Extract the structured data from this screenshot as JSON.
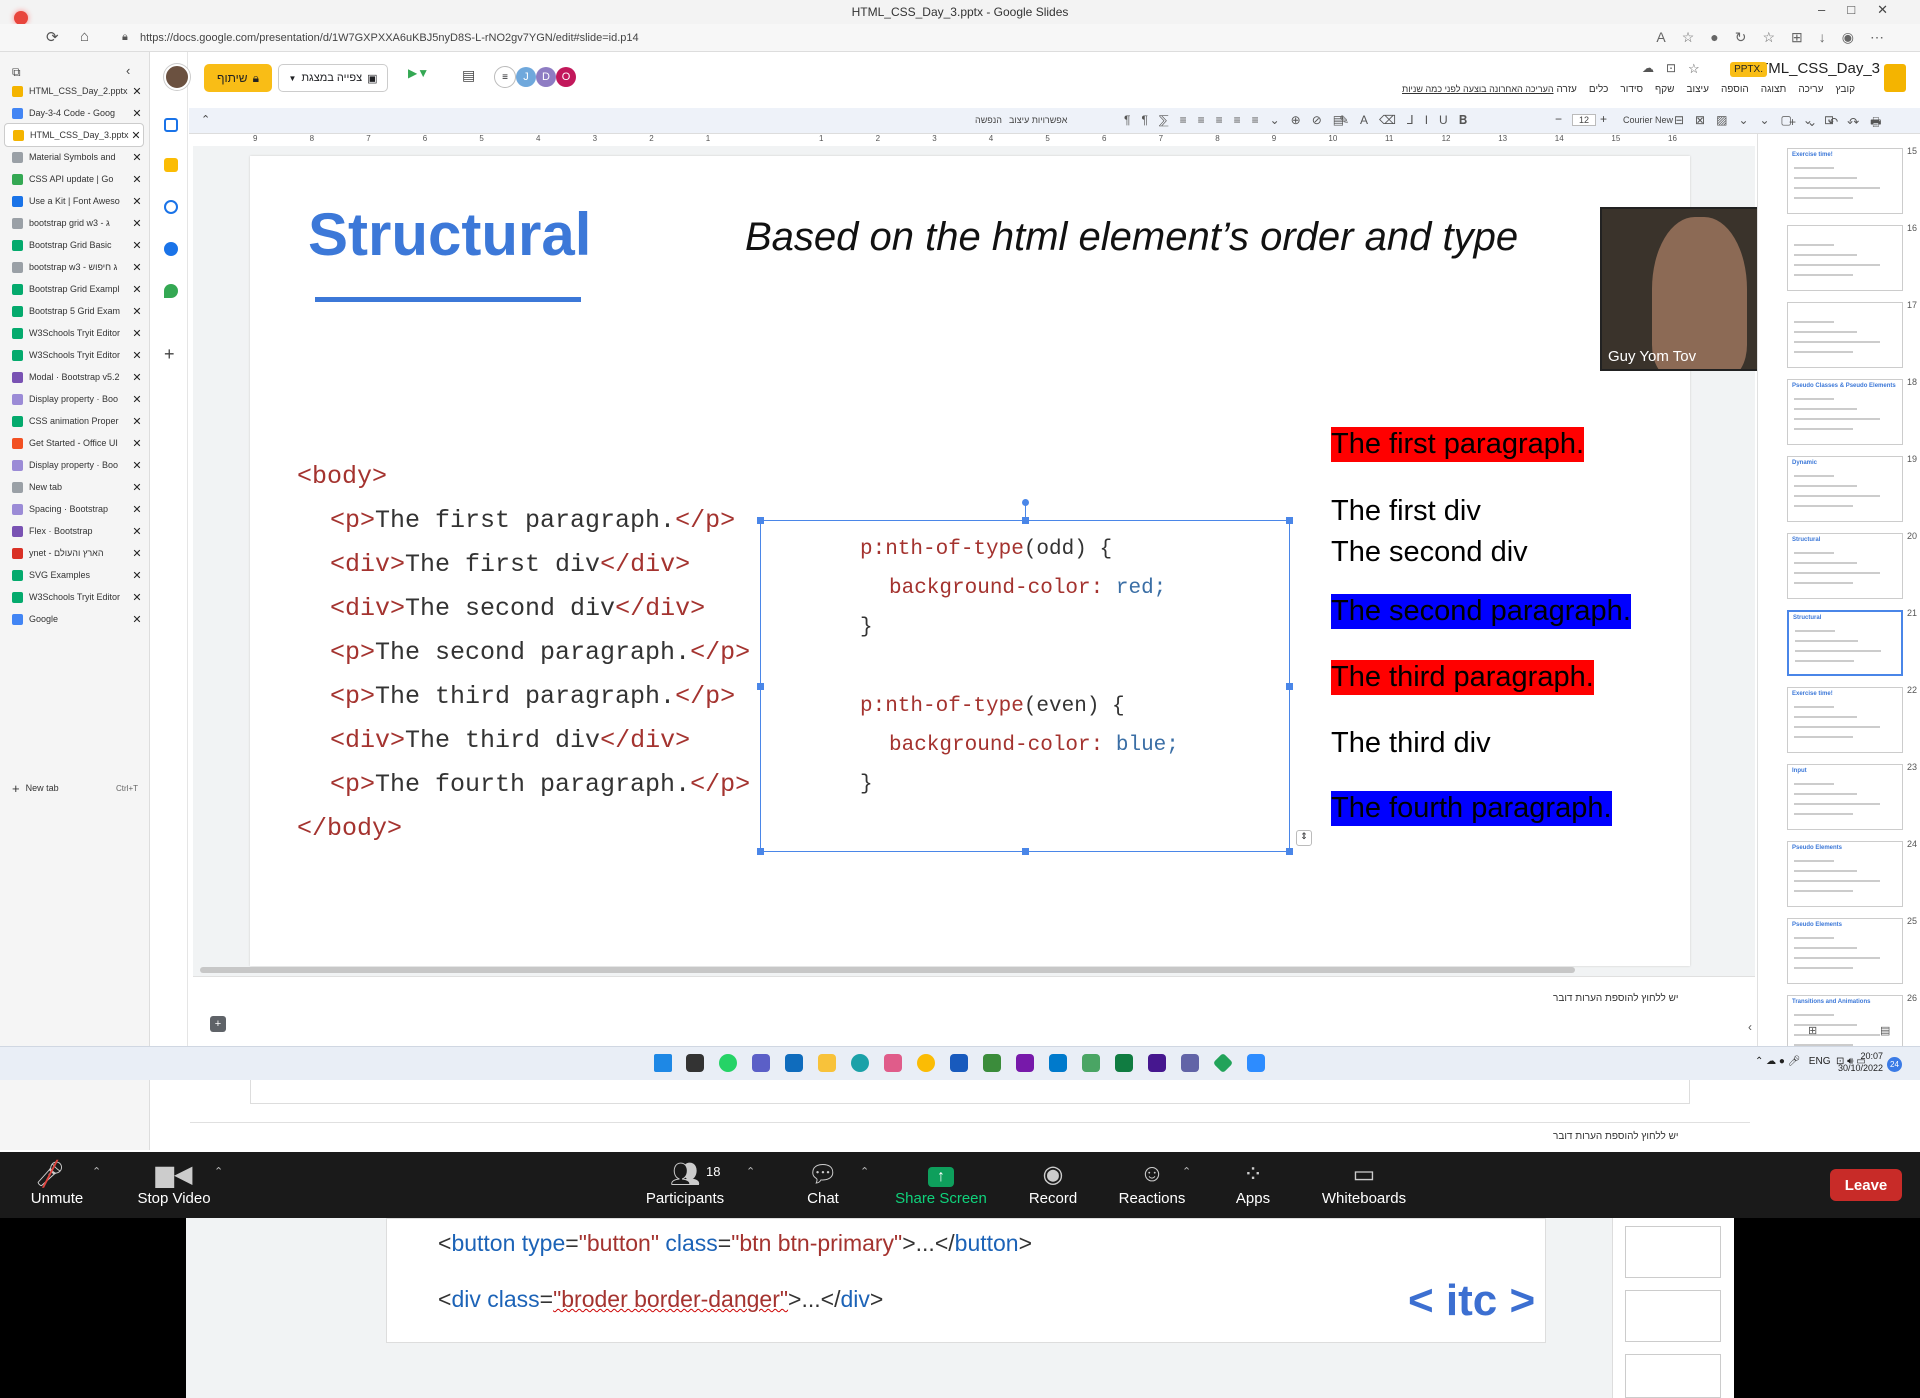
{
  "window": {
    "title": "HTML_CSS_Day_3.pptx - Google Slides",
    "controls": "–□✕"
  },
  "browser": {
    "url": "https://docs.google.com/presentation/d/1W7GXPXXA6uKBJ5nyD8S-L-rNO2gv7YGN/edit#slide=id.p14",
    "tabs": [
      {
        "label": "HTML_CSS_Day_2.pptx",
        "color": "#f4b400"
      },
      {
        "label": "Day-3-4 Code - Goog",
        "color": "#4285f4"
      },
      {
        "label": "HTML_CSS_Day_3.pptx",
        "color": "#f4b400",
        "active": true
      },
      {
        "label": "Material Symbols and",
        "color": "#9aa0a6"
      },
      {
        "label": "CSS API update | Go",
        "color": "#34a853"
      },
      {
        "label": "Use a Kit | Font Aweso",
        "color": "#1a73e8"
      },
      {
        "label": "bootstrap grid w3 - ג",
        "color": "#9aa0a6"
      },
      {
        "label": "Bootstrap Grid Basic",
        "color": "#04aa6d"
      },
      {
        "label": "bootstrap w3 - ג חיפוש",
        "color": "#9aa0a6"
      },
      {
        "label": "Bootstrap Grid Exampl",
        "color": "#04aa6d"
      },
      {
        "label": "Bootstrap 5 Grid Exam",
        "color": "#04aa6d"
      },
      {
        "label": "W3Schools Tryit Editor",
        "color": "#04aa6d"
      },
      {
        "label": "W3Schools Tryit Editor",
        "color": "#04aa6d"
      },
      {
        "label": "Modal · Bootstrap v5.2",
        "color": "#7952b3"
      },
      {
        "label": "Display property · Boo",
        "color": "#9b8bd6"
      },
      {
        "label": "CSS animation Proper",
        "color": "#04aa6d"
      },
      {
        "label": "Get Started - Office UI",
        "color": "#f25022"
      },
      {
        "label": "Display property · Boo",
        "color": "#9b8bd6"
      },
      {
        "label": "New tab",
        "color": "#9aa0a6"
      },
      {
        "label": "Spacing · Bootstrap",
        "color": "#9b8bd6"
      },
      {
        "label": "Flex · Bootstrap",
        "color": "#7952b3"
      },
      {
        "label": "ynet - הארץ והעולם",
        "color": "#d93025"
      },
      {
        "label": "SVG Examples",
        "color": "#04aa6d"
      },
      {
        "label": "W3Schools Tryit Editor",
        "color": "#04aa6d"
      },
      {
        "label": "Google",
        "color": "#4285f4"
      }
    ],
    "new_tab_label": "New tab",
    "new_tab_shortcut": "Ctrl+T"
  },
  "slides_app": {
    "doc_title": "HTML_CSS_Day_3",
    "file_badge": "PPTX.",
    "share_label": "שיתוף",
    "present_label": "צפייה במצגת",
    "last_edit": "העריכה האחרונה בוצעה לפני כמה שניות",
    "menu": [
      "קובץ",
      "עריכה",
      "תצוגה",
      "הוספה",
      "עיצוב",
      "שקף",
      "סידור",
      "כלים",
      "עזרה"
    ],
    "collaborators": [
      {
        "initial": "J",
        "color": "#6fa8dc"
      },
      {
        "initial": "D",
        "color": "#8e7cc3"
      },
      {
        "initial": "O",
        "color": "#c2185b"
      }
    ],
    "toolbar": {
      "font": "Courier New",
      "size": "12",
      "more_formats": "אפשרויות עיצוב",
      "transition": "הנפשה"
    },
    "ruler_numbers": [
      "9",
      "8",
      "7",
      "6",
      "5",
      "4",
      "3",
      "2",
      "1",
      "",
      "1",
      "2",
      "3",
      "4",
      "5",
      "6",
      "7",
      "8",
      "9",
      "10",
      "11",
      "12",
      "13",
      "14",
      "15",
      "16"
    ],
    "speaker_notes_placeholder": "יש ללחוץ להוספת הערות דובר"
  },
  "slide": {
    "title": "Structural",
    "subtitle": "Based on the html element’s order and type",
    "html_lines": [
      {
        "indent": 0,
        "tag_open": "<body>",
        "text": "",
        "tag_close": ""
      },
      {
        "indent": 1,
        "tag_open": "<p>",
        "text": "The first paragraph.",
        "tag_close": "</p>"
      },
      {
        "indent": 1,
        "tag_open": "<div>",
        "text": "The first div",
        "tag_close": "</div>"
      },
      {
        "indent": 1,
        "tag_open": "<div>",
        "text": "The second div",
        "tag_close": "</div>"
      },
      {
        "indent": 1,
        "tag_open": "<p>",
        "text": "The second paragraph.",
        "tag_close": "</p>"
      },
      {
        "indent": 1,
        "tag_open": "<p>",
        "text": "The third paragraph.",
        "tag_close": "</p>"
      },
      {
        "indent": 1,
        "tag_open": "<div>",
        "text": "The third div",
        "tag_close": "</div>"
      },
      {
        "indent": 1,
        "tag_open": "<p>",
        "text": "The fourth paragraph.",
        "tag_close": "</p>"
      },
      {
        "indent": 0,
        "tag_open": "</body>",
        "text": "",
        "tag_close": ""
      }
    ],
    "css_rules": [
      {
        "selector": "p:nth-of-type",
        "arg": "(odd) {",
        "prop": "background-color:",
        "value": "red;",
        "close": "}"
      },
      {
        "selector": "p:nth-of-type",
        "arg": "(even) {",
        "prop": "background-color:",
        "value": "blue;",
        "close": "}"
      }
    ],
    "results": [
      {
        "text": "The first paragraph.",
        "bg": "#ff0000"
      },
      {
        "text": "The first div",
        "bg": ""
      },
      {
        "text": "The second div",
        "bg": ""
      },
      {
        "text": "The second paragraph.",
        "bg": "#0000ff"
      },
      {
        "text": "The third paragraph.",
        "bg": "#ff0000"
      },
      {
        "text": "The third div",
        "bg": ""
      },
      {
        "text": "The fourth paragraph.",
        "bg": "#0000ff"
      }
    ]
  },
  "webcam": {
    "name": "Guy Yom Tov"
  },
  "filmstrip": {
    "slides": [
      {
        "num": "15",
        "title": "Exercise time!"
      },
      {
        "num": "16",
        "title": ""
      },
      {
        "num": "17",
        "title": ""
      },
      {
        "num": "18",
        "title": "Pseudo Classes & Pseudo Elements"
      },
      {
        "num": "19",
        "title": "Dynamic"
      },
      {
        "num": "20",
        "title": "Structural"
      },
      {
        "num": "21",
        "title": "Structural",
        "active": true
      },
      {
        "num": "22",
        "title": "Exercise time!"
      },
      {
        "num": "23",
        "title": "Input"
      },
      {
        "num": "24",
        "title": "Pseudo Elements"
      },
      {
        "num": "25",
        "title": "Pseudo Elements"
      },
      {
        "num": "26",
        "title": "Transitions and Animations"
      }
    ]
  },
  "taskbar": {
    "lang": "ENG",
    "time": "20:07",
    "date": "30/10/2022",
    "badge": "24"
  },
  "zoom": {
    "unmute": "Unmute",
    "stop_video": "Stop Video",
    "participants": "Participants",
    "participants_count": "18",
    "chat": "Chat",
    "share_screen": "Share Screen",
    "record": "Record",
    "reactions": "Reactions",
    "apps": "Apps",
    "whiteboards": "Whiteboards",
    "leave": "Leave"
  },
  "bottom_slide": {
    "line1": {
      "open": "<",
      "tag": "button",
      "attr1": " type",
      "eq1": "=",
      "val1": "\"button\"",
      "attr2": " class",
      "eq2": "=",
      "val2": "\"btn btn-primary\"",
      "rest": ">...</",
      "ctag": "button",
      "end": ">"
    },
    "line2": {
      "open": "<",
      "tag": "div",
      "attr1": " class",
      "eq1": "=",
      "val1": "\"broder border-danger\"",
      "rest": ">...</",
      "ctag": "div",
      "end": ">"
    },
    "logo": "< itc >"
  }
}
